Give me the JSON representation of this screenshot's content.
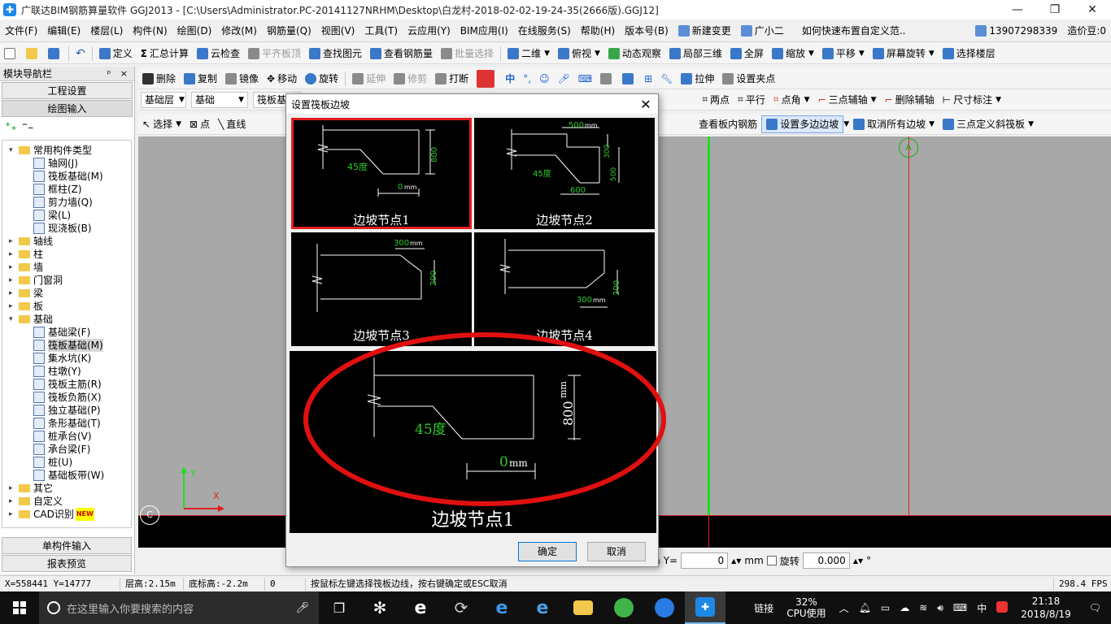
{
  "window": {
    "title": "广联达BIM钢筋算量软件 GGJ2013 - [C:\\Users\\Administrator.PC-20141127NRHM\\Desktop\\白龙村-2018-02-02-19-24-35(2666版).GGJ12]",
    "min_glyph": "—",
    "max_glyph": "❐",
    "close_glyph": "✕"
  },
  "menu": {
    "items": [
      "文件(F)",
      "编辑(E)",
      "楼层(L)",
      "构件(N)",
      "绘图(D)",
      "修改(M)",
      "钢筋量(Q)",
      "视图(V)",
      "工具(T)",
      "云应用(Y)",
      "BIM应用(I)",
      "在线服务(S)",
      "帮助(H)",
      "版本号(B)"
    ],
    "new_change": "新建变更",
    "assistant": "广小二",
    "promo": "如何快速布置自定义范..",
    "phone": "13907298339",
    "price_bean": "造价豆:0"
  },
  "toolbar1": {
    "define": "定义",
    "sum_calc": "汇总计算",
    "cloud_check": "云检查",
    "flat_slab_top": "平齐板顶",
    "find_element": "查找图元",
    "view_rebar": "查看钢筋量",
    "batch_select": "批量选择",
    "view_2d": "二维",
    "top_view": "俯视",
    "dynamic_observe": "动态观察",
    "local_3d": "局部三维",
    "full_screen": "全屏",
    "zoom": "缩放",
    "pan": "平移",
    "screen_rotate": "屏幕旋转",
    "select_floor": "选择楼层"
  },
  "toolbar2": {
    "delete": "删除",
    "copy": "复制",
    "mirror": "镜像",
    "move": "移动",
    "rotate": "旋转",
    "extend": "延伸",
    "trim": "修剪",
    "break": "打断",
    "ime_cn": "中",
    "stretch": "拉伸",
    "set_grip": "设置夹点"
  },
  "toolbar3": {
    "layer": "基础层",
    "category": "基础",
    "subtype": "筏板基",
    "two_points": "两点",
    "parallel": "平行",
    "point_angle": "点角",
    "three_point_axis": "三点辅轴",
    "delete_axis": "删除辅轴",
    "dimension": "尺寸标注"
  },
  "toolbar4": {
    "select": "选择",
    "point": "点",
    "line": "直线",
    "view_slab_rebar": "查看板内钢筋",
    "set_multi_slope": "设置多边边坡",
    "cancel_all_slope": "取消所有边坡",
    "three_point_slope": "三点定义斜筏板"
  },
  "left_panel": {
    "title": "模块导航栏",
    "pins": "ᵖ ×",
    "project_settings": "工程设置",
    "drawing_input": "绘图输入",
    "single_input": "单构件输入",
    "report_preview": "报表预览",
    "tree": [
      {
        "label": "常用构件类型",
        "level": 0,
        "type": "folder",
        "expanded": true
      },
      {
        "label": "轴网(J)",
        "level": 1,
        "type": "leaf"
      },
      {
        "label": "筏板基础(M)",
        "level": 1,
        "type": "leaf"
      },
      {
        "label": "框柱(Z)",
        "level": 1,
        "type": "leaf"
      },
      {
        "label": "剪力墙(Q)",
        "level": 1,
        "type": "leaf"
      },
      {
        "label": "梁(L)",
        "level": 1,
        "type": "leaf"
      },
      {
        "label": "现浇板(B)",
        "level": 1,
        "type": "leaf"
      },
      {
        "label": "轴线",
        "level": 0,
        "type": "folder",
        "expanded": false
      },
      {
        "label": "柱",
        "level": 0,
        "type": "folder",
        "expanded": false
      },
      {
        "label": "墙",
        "level": 0,
        "type": "folder",
        "expanded": false
      },
      {
        "label": "门窗洞",
        "level": 0,
        "type": "folder",
        "expanded": false
      },
      {
        "label": "梁",
        "level": 0,
        "type": "folder",
        "expanded": false
      },
      {
        "label": "板",
        "level": 0,
        "type": "folder",
        "expanded": false
      },
      {
        "label": "基础",
        "level": 0,
        "type": "folder",
        "expanded": true
      },
      {
        "label": "基础梁(F)",
        "level": 1,
        "type": "leaf"
      },
      {
        "label": "筏板基础(M)",
        "level": 1,
        "type": "leaf",
        "selected": true
      },
      {
        "label": "集水坑(K)",
        "level": 1,
        "type": "leaf"
      },
      {
        "label": "柱墩(Y)",
        "level": 1,
        "type": "leaf"
      },
      {
        "label": "筏板主筋(R)",
        "level": 1,
        "type": "leaf"
      },
      {
        "label": "筏板负筋(X)",
        "level": 1,
        "type": "leaf"
      },
      {
        "label": "独立基础(P)",
        "level": 1,
        "type": "leaf"
      },
      {
        "label": "条形基础(T)",
        "level": 1,
        "type": "leaf"
      },
      {
        "label": "桩承台(V)",
        "level": 1,
        "type": "leaf"
      },
      {
        "label": "承台梁(F)",
        "level": 1,
        "type": "leaf"
      },
      {
        "label": "桩(U)",
        "level": 1,
        "type": "leaf"
      },
      {
        "label": "基础板带(W)",
        "level": 1,
        "type": "leaf"
      },
      {
        "label": "其它",
        "level": 0,
        "type": "folder",
        "expanded": false
      },
      {
        "label": "自定义",
        "level": 0,
        "type": "folder",
        "expanded": false
      },
      {
        "label": "CAD识别",
        "level": 0,
        "type": "folder",
        "expanded": false,
        "badge": "NEW"
      }
    ]
  },
  "canvas": {
    "axis_top_label": "A",
    "axis_left_label": "C",
    "x_axis": "X",
    "y_axis": "Y"
  },
  "coordbar": {
    "unit1": "m",
    "y_label": "Y=",
    "y_value": "0",
    "unit2": "mm",
    "rotate_label": "旋转",
    "rotate_value": "0.000",
    "degree": "°"
  },
  "statusbar": {
    "coords": "X=558441 Y=14777",
    "floor_height": "层高:2.15m",
    "bottom_height": "底标高:-2.2m",
    "zero": "0",
    "hint": "按鼠标左键选择筏板边线，按右键确定或ESC取消",
    "fps": "298.4 FPS"
  },
  "dialog": {
    "title": "设置筏板边坡",
    "nodes": [
      {
        "label": "边坡节点1",
        "dim_vertical": "800",
        "dim_bottom": "0",
        "angle": "45度",
        "unit": "mm"
      },
      {
        "label": "边坡节点2",
        "dim_top": "500",
        "dim_right_small": "300",
        "dim_right": "500",
        "dim_bottom": "600",
        "angle": "45度",
        "unit": "mm"
      },
      {
        "label": "边坡节点3",
        "dim_top": "300",
        "dim_vertical": "200",
        "unit": "mm"
      },
      {
        "label": "边坡节点4",
        "dim_bottom": "300",
        "dim_vertical": "200",
        "unit": "mm"
      }
    ],
    "preview": {
      "label": "边坡节点1",
      "dim_vertical": "800",
      "dim_bottom": "0",
      "angle": "45度",
      "unit": "mm"
    },
    "ok": "确定",
    "cancel": "取消"
  },
  "taskbar": {
    "search_placeholder": "在这里输入你要搜索的内容",
    "network": "链接",
    "cpu_percent": "32%",
    "cpu_label": "CPU使用",
    "ime": "中",
    "time": "21:18",
    "date": "2018/8/19"
  }
}
